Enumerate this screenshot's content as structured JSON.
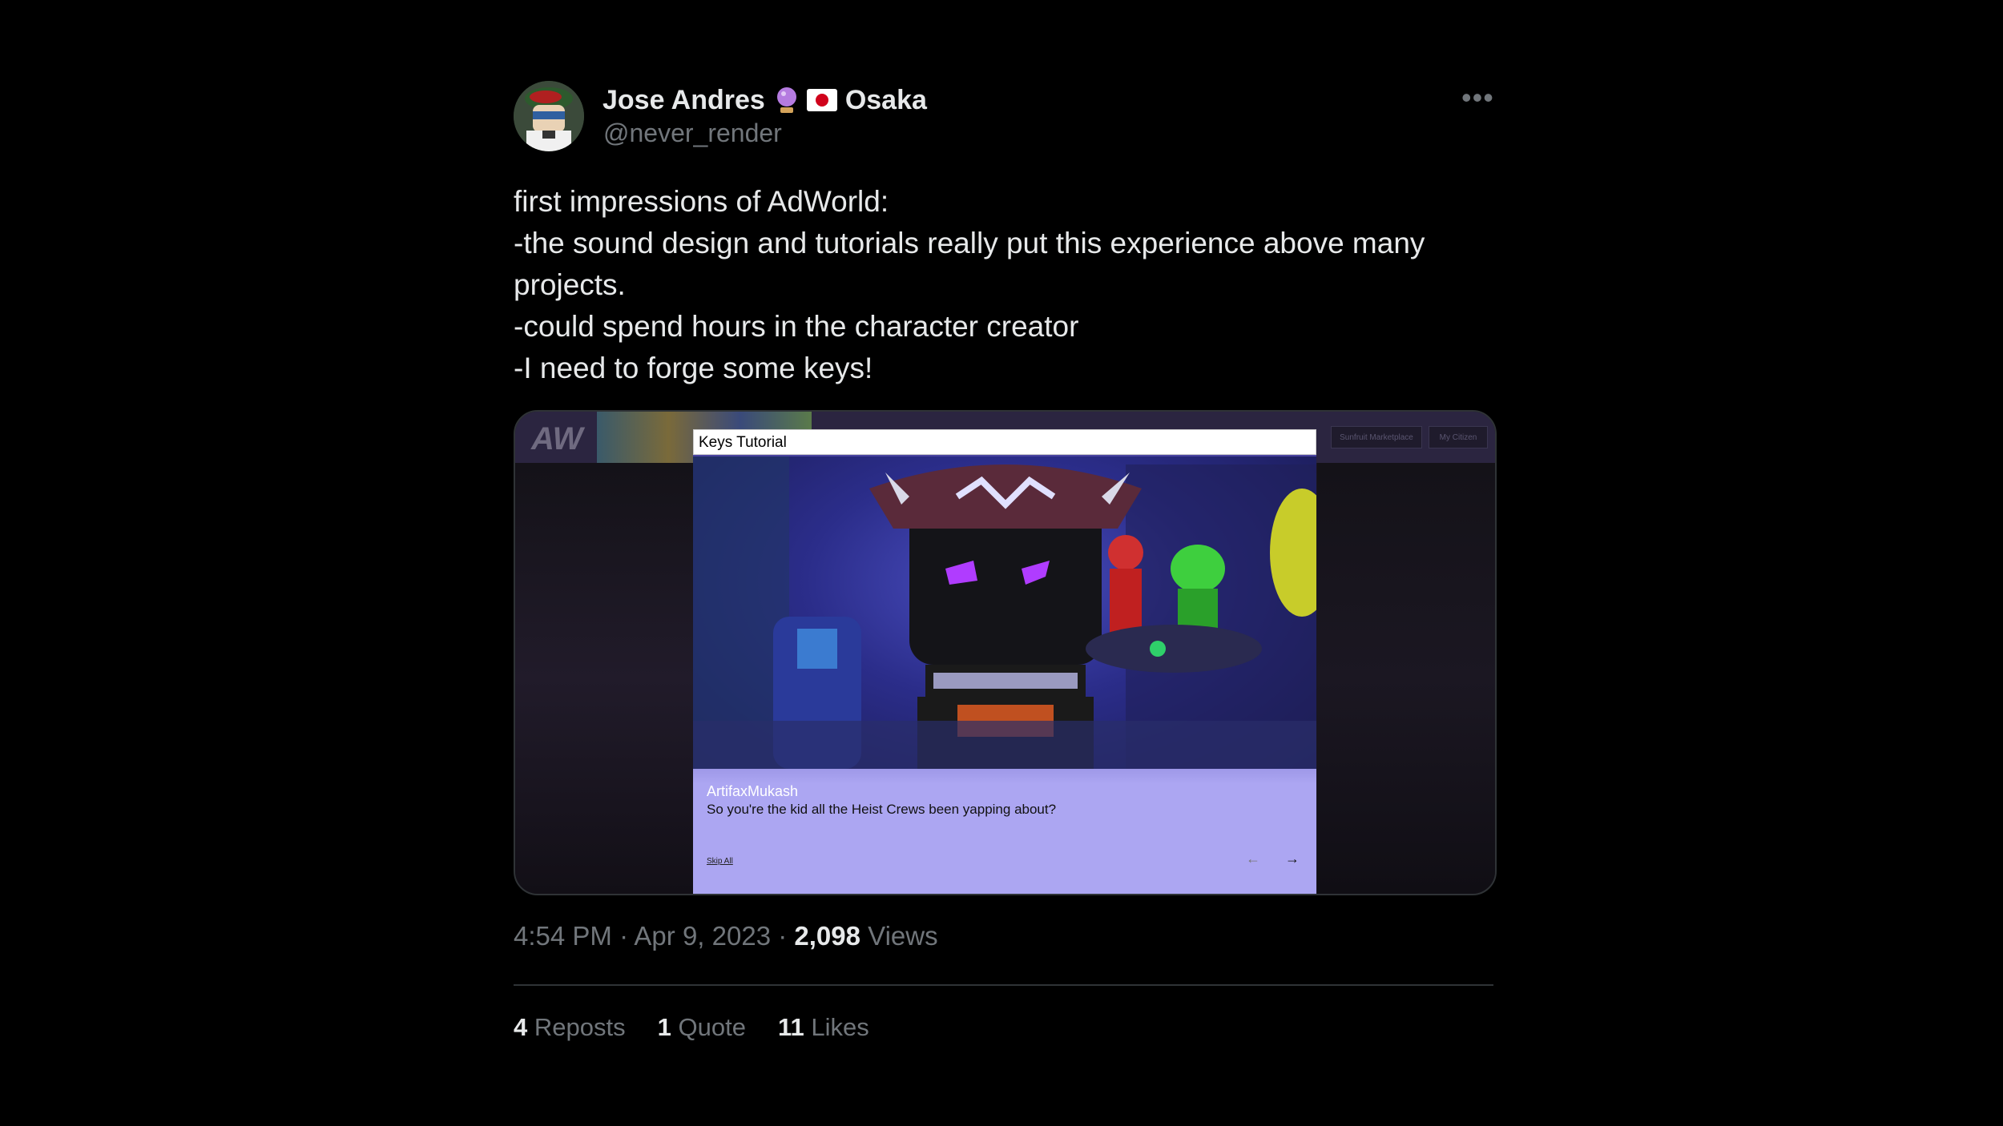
{
  "author": {
    "name": "Jose Andres",
    "location": "Osaka",
    "handle": "@never_render"
  },
  "tweet": {
    "lines": [
      "first impressions of AdWorld:",
      "-the sound design and tutorials really put this experience above many",
      "projects.",
      "-could spend hours in the character creator",
      "-I need to forge some keys!"
    ]
  },
  "media": {
    "logo": "AW",
    "nav_buttons": [
      "Sunfruit Marketplace",
      "My Citizen"
    ],
    "modal_title": "Keys Tutorial",
    "speaker": "ArtifaxMukash",
    "dialog_line": "So you're the kid all the Heist Crews been yapping about?",
    "skip_label": "Skip All",
    "prev_arrow": "←",
    "next_arrow": "→"
  },
  "meta": {
    "time": "4:54 PM",
    "date": "Apr 9, 2023",
    "views_count": "2,098",
    "views_label": "Views"
  },
  "stats": {
    "reposts_count": "4",
    "reposts_label": "Reposts",
    "quote_count": "1",
    "quote_label": "Quote",
    "likes_count": "11",
    "likes_label": "Likes"
  },
  "icons": {
    "more": "more-dots-icon",
    "orb": "crystal-ball-icon",
    "flag": "japan-flag-icon"
  }
}
